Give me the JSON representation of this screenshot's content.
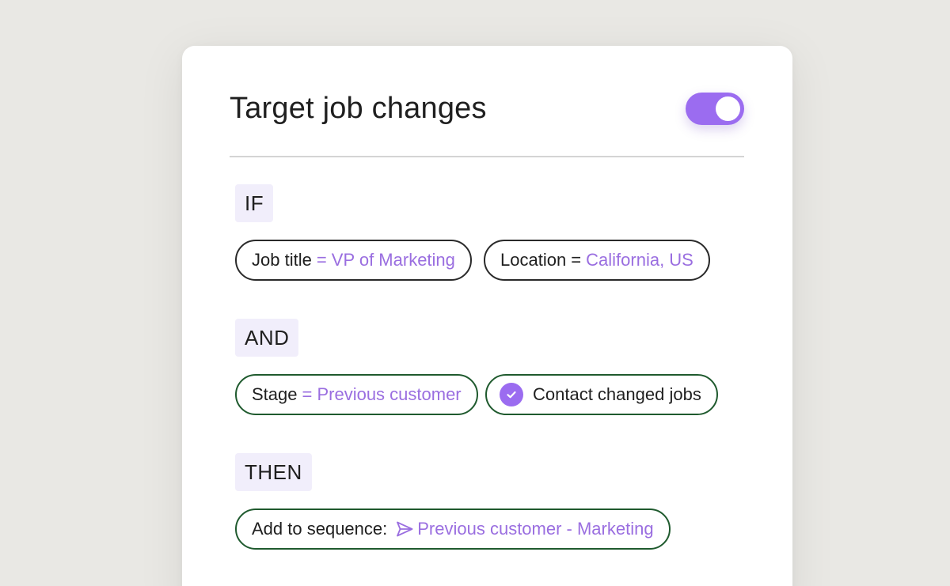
{
  "card": {
    "title": "Target job changes",
    "toggle_on": true
  },
  "sections": {
    "if_label": "IF",
    "and_label": "AND",
    "then_label": "THEN"
  },
  "conditions_if": [
    {
      "key": "Job title",
      "value": "= VP of Marketing"
    },
    {
      "key": "Location =",
      "value": "California, US"
    }
  ],
  "conditions_and": [
    {
      "key": "Stage",
      "value": "= Previous customer"
    },
    {
      "key": "Contact changed jobs",
      "icon": "check-circle-icon"
    }
  ],
  "action_then": {
    "key": "Add to sequence:",
    "icon": "send-icon",
    "value": "Previous customer - Marketing"
  },
  "colors": {
    "accent": "#9b6cf0",
    "value_text": "#9a6ee0",
    "label_bg": "#f1eefb",
    "pill_border_dark": "#2a2a2a",
    "pill_border_green": "#1f5a2e",
    "background": "#e9e8e4"
  }
}
